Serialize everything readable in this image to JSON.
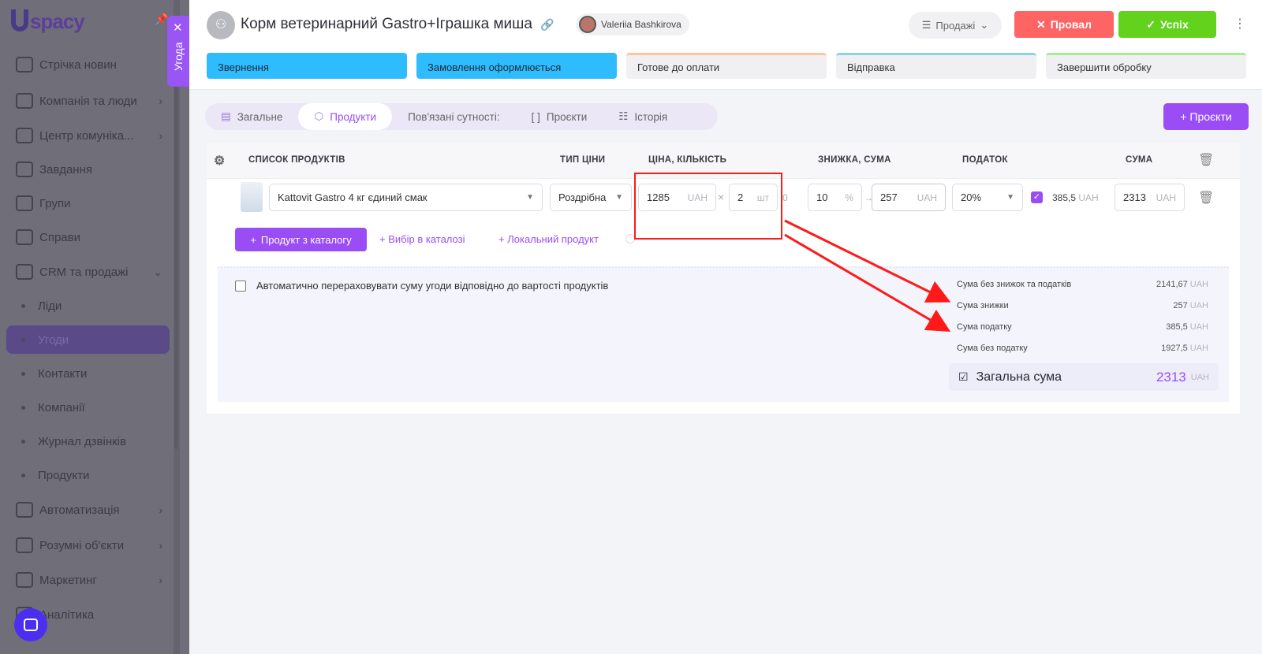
{
  "sidebar": {
    "logo": "spacy",
    "items": [
      {
        "label": "Стрічка новин",
        "icon": "home-icon"
      },
      {
        "label": "Компанія та люди",
        "icon": "building-icon",
        "chevron": true
      },
      {
        "label": "Центр комуніка...",
        "icon": "chat-phone-icon",
        "chevron": true
      },
      {
        "label": "Завдання",
        "icon": "check-circle-icon"
      },
      {
        "label": "Групи",
        "icon": "users-icon"
      },
      {
        "label": "Справи",
        "icon": "calendar-icon"
      },
      {
        "label": "CRM та продажі",
        "icon": "database-icon",
        "chevron": true
      },
      {
        "label": "Ліди",
        "sub": true
      },
      {
        "label": "Угоди",
        "sub": true,
        "active": true
      },
      {
        "label": "Контакти",
        "sub": true
      },
      {
        "label": "Компанії",
        "sub": true
      },
      {
        "label": "Журнал дзвінків",
        "sub": true
      },
      {
        "label": "Продукти",
        "sub": true
      },
      {
        "label": "Автоматизація",
        "icon": "lightning-icon",
        "chevron": true
      },
      {
        "label": "Розумні об'єкти",
        "icon": "scan-icon",
        "chevron": true
      },
      {
        "label": "Маркетинг",
        "icon": "megaphone-icon",
        "chevron": true
      },
      {
        "label": "Аналітика",
        "icon": "chart-icon"
      }
    ],
    "deal_tab": "Угода"
  },
  "header": {
    "title": "Корм ветеринарний Gastro+Іграшка миша",
    "user": "Valeriia Bashkirova",
    "funnel": "Продажі",
    "fail": "Провал",
    "success": "Успіх",
    "stages": [
      {
        "label": "Звернення",
        "done": true,
        "color": "#2ebcff"
      },
      {
        "label": "Замовлення оформлюється",
        "done": true,
        "color": "#2ebcff"
      },
      {
        "label": "Готове до оплати",
        "done": false,
        "color": "#ffc49a"
      },
      {
        "label": "Відправка",
        "done": false,
        "color": "#8fd3e0"
      },
      {
        "label": "Завершити обробку",
        "done": false,
        "color": "#a3ef8f"
      }
    ]
  },
  "tabs": [
    "Загальне",
    "Продукти",
    "Пов'язані сутності:",
    "Проєкти",
    "Історія"
  ],
  "add_projects": "+ Проєкти",
  "table": {
    "headers": {
      "list": "СПИСОК ПРОДУКТІВ",
      "price_type": "ТИП ЦІНИ",
      "price_qty": "ЦІНА, КІЛЬКІСТЬ",
      "discount": "ЗНИЖКА, СУМА",
      "tax": "ПОДАТОК",
      "sum": "СУМА"
    },
    "row": {
      "product": "Kattovit Gastro 4 кг єдиний смак",
      "price_type": "Роздрібна",
      "price": "1285",
      "currency": "UAH",
      "qty": "2",
      "unit": "шт",
      "extra": "0",
      "discount_pct": "10",
      "pct": "%",
      "discount_sum": "257",
      "tax": "20%",
      "tax_checked": true,
      "tax_sum": "385,5",
      "sum": "2313"
    }
  },
  "actions": {
    "from_catalog": "Продукт з каталогу",
    "catalog_pick": "Вибір в каталозі",
    "local": "Локальний продукт"
  },
  "summary": {
    "auto_label": "Автоматично перераховувати суму угоди відповідно до вартості продуктів",
    "rows": [
      {
        "label": "Сума без знижок та податків",
        "value": "2141,67"
      },
      {
        "label": "Сума знижки",
        "value": "257"
      },
      {
        "label": "Сума податку",
        "value": "385,5"
      },
      {
        "label": "Сума без податку",
        "value": "1927,5"
      }
    ],
    "currency": "UAH",
    "total_label": "Загальна сума",
    "total": "2313"
  }
}
